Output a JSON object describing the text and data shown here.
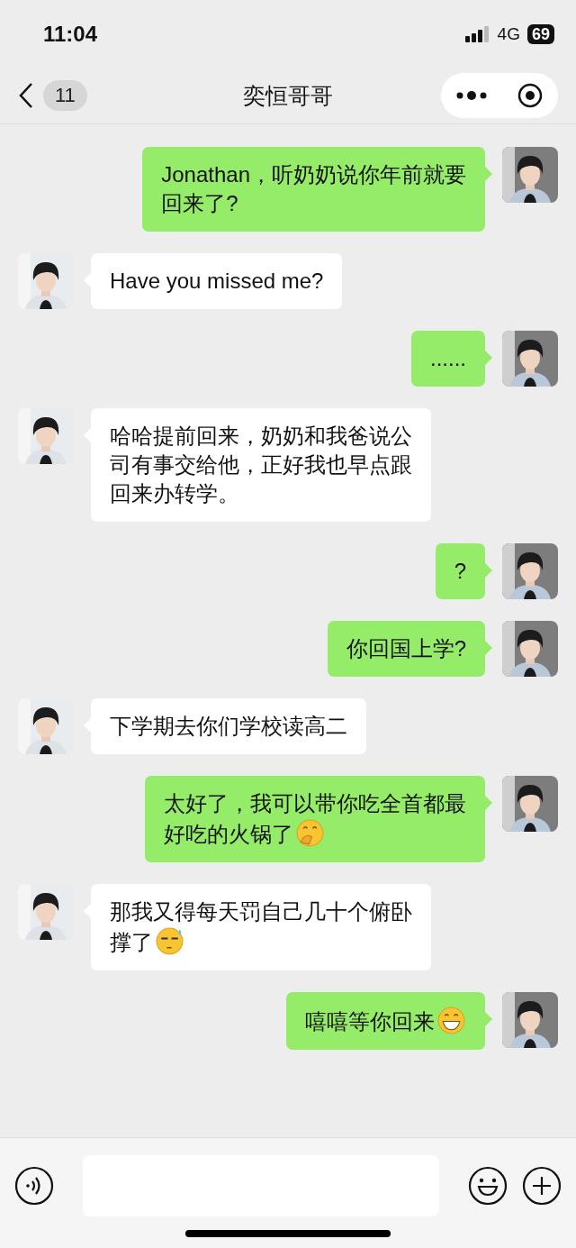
{
  "status_bar": {
    "time": "11:04",
    "network": "4G",
    "battery": "69"
  },
  "header": {
    "unread_count": "11",
    "title": "奕恒哥哥"
  },
  "messages": [
    {
      "kind": "sent",
      "lines": [
        "Jonathan，听奶奶说你年前就要",
        "回来了?"
      ]
    },
    {
      "kind": "received",
      "lines": [
        "Have you missed me?"
      ]
    },
    {
      "kind": "sent",
      "lines": [
        "......"
      ]
    },
    {
      "kind": "received",
      "lines": [
        "哈哈提前回来，奶奶和我爸说公",
        "司有事交给他，正好我也早点跟",
        "回来办转学。"
      ]
    },
    {
      "kind": "sent",
      "lines": [
        "?"
      ]
    },
    {
      "kind": "sent",
      "lines": [
        "你回国上学?"
      ]
    },
    {
      "kind": "received",
      "lines": [
        "下学期去你们学校读高二"
      ]
    },
    {
      "kind": "sent",
      "lines": [
        "太好了，我可以带你吃全首都最",
        "好吃的火锅了"
      ],
      "emoji": {
        "kind": "giggle"
      }
    },
    {
      "kind": "received",
      "lines": [
        "那我又得每天罚自己几十个俯卧",
        "撑了"
      ],
      "emoji": {
        "kind": "sweat"
      }
    },
    {
      "kind": "sent",
      "lines": [
        "嘻嘻等你回来"
      ],
      "emoji": {
        "kind": "grin"
      }
    }
  ]
}
